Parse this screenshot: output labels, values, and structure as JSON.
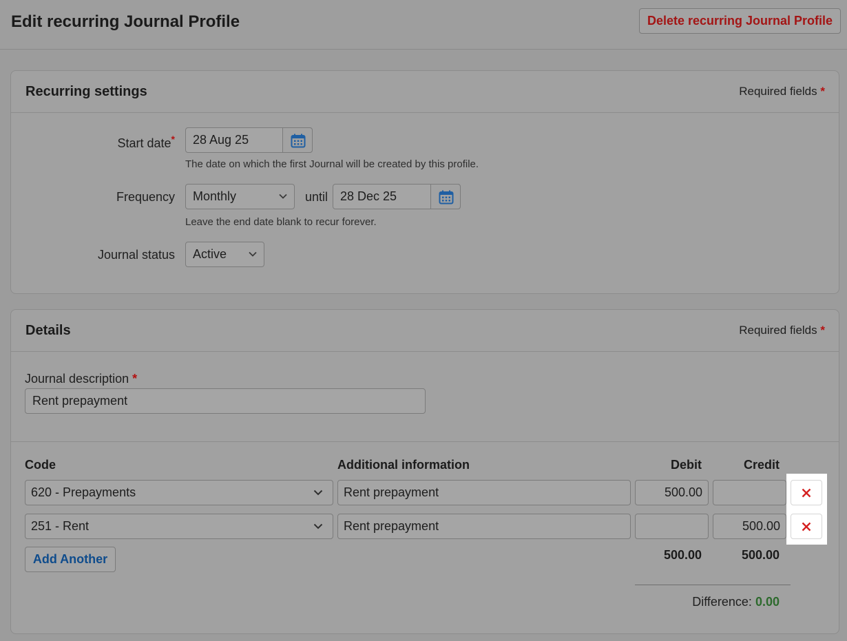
{
  "header": {
    "title": "Edit recurring Journal Profile",
    "delete_label": "Delete recurring Journal Profile"
  },
  "recurring": {
    "title": "Recurring settings",
    "required_label": "Required fields",
    "required_star": "*",
    "start_date_label": "Start date",
    "start_date_star": "*",
    "start_date_value": "28 Aug 25",
    "start_date_hint": "The date on which the first Journal will be created by this profile.",
    "frequency_label": "Frequency",
    "frequency_value": "Monthly",
    "until_label": "until",
    "end_date_value": "28 Dec 25",
    "end_date_hint": "Leave the end date blank to recur forever.",
    "status_label": "Journal status",
    "status_value": "Active"
  },
  "details": {
    "title": "Details",
    "required_label": "Required fields",
    "required_star": "*",
    "description_label": "Journal description",
    "description_star": "*",
    "description_value": "Rent prepayment",
    "columns": {
      "code": "Code",
      "info": "Additional information",
      "debit": "Debit",
      "credit": "Credit"
    },
    "lines": [
      {
        "code": "620 - Prepayments",
        "info": "Rent prepayment",
        "debit": "500.00",
        "credit": ""
      },
      {
        "code": "251 - Rent",
        "info": "Rent prepayment",
        "debit": "",
        "credit": "500.00"
      }
    ],
    "add_label": "Add Another",
    "total_debit": "500.00",
    "total_credit": "500.00",
    "difference_label": "Difference:",
    "difference_value": "0.00"
  },
  "icons": {
    "calendar": "calendar-icon",
    "chevron": "chevron-down-icon",
    "remove": "close-icon"
  },
  "colors": {
    "danger": "#a31515",
    "link": "#0f4c8c",
    "success": "#2d6a2d",
    "calendar_icon": "#1f5fa3"
  }
}
